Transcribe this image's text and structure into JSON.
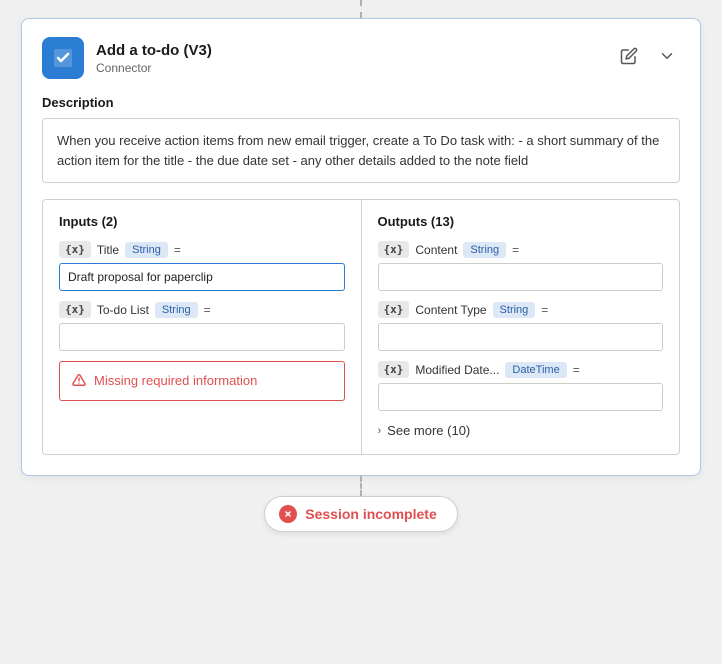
{
  "header": {
    "title": "Add a to-do (V3)",
    "subtitle": "Connector",
    "edit_icon": "✎",
    "collapse_icon": "∨"
  },
  "description": {
    "label": "Description",
    "text": "When you receive action items from new email trigger, create a To Do task with: - a short summary of the action item for the title - the due date set - any other details added to the note field"
  },
  "inputs": {
    "title": "Inputs (2)",
    "rows": [
      {
        "var": "{x}",
        "label": "Title",
        "type": "String",
        "eq": "=",
        "value": "Draft proposal for paperclip"
      },
      {
        "var": "{x}",
        "label": "To-do List",
        "type": "String",
        "eq": "=",
        "value": ""
      }
    ],
    "error": {
      "text": "Missing required information"
    }
  },
  "outputs": {
    "title": "Outputs (13)",
    "rows": [
      {
        "var": "{x}",
        "label": "Content",
        "type": "String",
        "eq": "=",
        "value": ""
      },
      {
        "var": "{x}",
        "label": "Content Type",
        "type": "String",
        "eq": "=",
        "value": ""
      },
      {
        "var": "{x}",
        "label": "Modified Date...",
        "type": "DateTime",
        "eq": "=",
        "value": ""
      }
    ],
    "see_more": "See more (10)"
  },
  "session": {
    "text": "Session incomplete"
  }
}
